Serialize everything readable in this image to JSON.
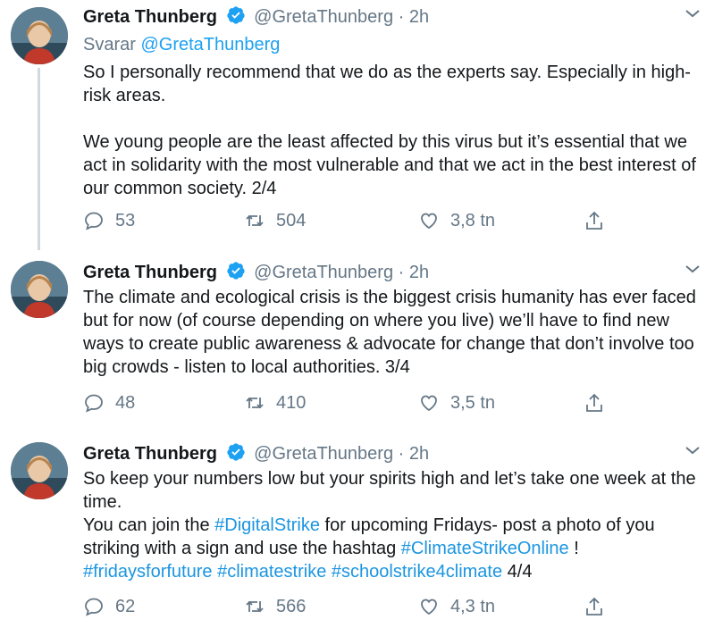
{
  "tweets": [
    {
      "name": "Greta Thunberg",
      "handle": "@GretaThunberg",
      "sep": "·",
      "time": "2h",
      "replying_prefix": "Svarar",
      "replying_to": "@GretaThunberg",
      "para1": "So I personally recommend that we do as the experts say. Especially in high-risk areas.",
      "para2": "We young people are the least affected by this virus but it’s essential that we act in solidarity with the most vulnerable and that we act in the best interest of our common society. 2/4",
      "replies": "53",
      "retweets": "504",
      "likes": "3,8 tn"
    },
    {
      "name": "Greta Thunberg",
      "handle": "@GretaThunberg",
      "sep": "·",
      "time": "2h",
      "para1": "The climate and ecological crisis is the biggest crisis humanity has ever faced but for now (of course depending on where you live) we’ll have to find new ways to create public awareness & advocate for change that don’t involve too big crowds - listen to local authorities. 3/4",
      "replies": "48",
      "retweets": "410",
      "likes": "3,5 tn"
    },
    {
      "name": "Greta Thunberg",
      "handle": "@GretaThunberg",
      "sep": "·",
      "time": "2h",
      "line1": "So keep your numbers low but your spirits high and let’s take one week at the time.",
      "line2_a": "You can join the ",
      "tag_digital": "#DigitalStrike",
      "line2_b": " for upcoming Fridays- post a photo of you striking with a sign and use the hashtag ",
      "tag_online": "#ClimateStrikeOnline",
      "line2_c": " !",
      "tag_fff": "#fridaysforfuture",
      "tag_cs": "#climatestrike",
      "tag_ss": "#schoolstrike4climate",
      "line3_end": " 4/4",
      "replies": "62",
      "retweets": "566",
      "likes": "4,3 tn"
    }
  ],
  "colors": {
    "link": "#1da1f2",
    "muted": "#657786",
    "verified": "#1da1f2"
  },
  "icons": [
    "verified-badge-icon",
    "chevron-down-icon",
    "reply-icon",
    "retweet-icon",
    "like-icon",
    "share-icon"
  ]
}
